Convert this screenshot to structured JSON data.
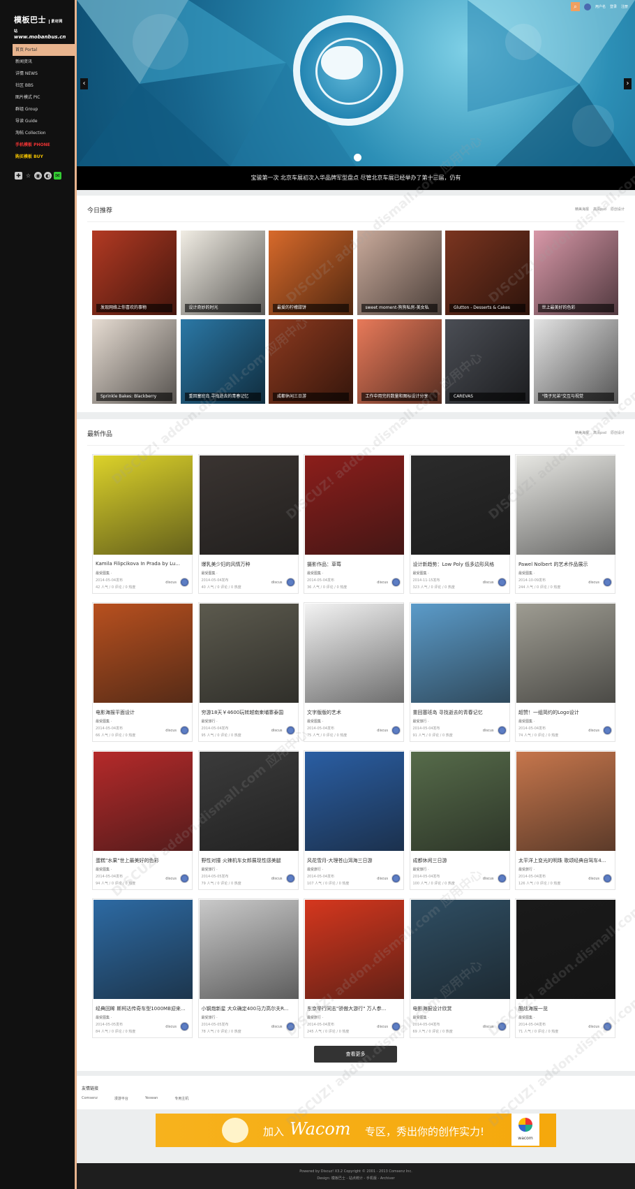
{
  "logo": {
    "line1": "模板巴士",
    "line1b": "素材网站",
    "line2": "www.mobanbus.cn"
  },
  "nav": [
    {
      "label": "首页 Portal",
      "active": true
    },
    {
      "label": "新闻资讯"
    },
    {
      "label": "详情 NEWS"
    },
    {
      "label": "社区 BBS"
    },
    {
      "label": "图片模式 PIC"
    },
    {
      "label": "群组 Group"
    },
    {
      "label": "导读 Guide"
    },
    {
      "label": "淘帖 Collection"
    },
    {
      "label": "手机模板 PHONE",
      "color": "red"
    },
    {
      "label": "购买模板 BUY",
      "color": "yellow"
    }
  ],
  "social_icons": [
    "plus-icon",
    "star-icon",
    "weibo-icon",
    "qq-icon",
    "wechat-icon"
  ],
  "topbar": {
    "user": "用户名",
    "login": "登录",
    "register": "注册"
  },
  "banner": {
    "caption": "宝骏第一次  北京车展初次入华品牌军型盘点  尽管北京车展已经举办了第十三届，仍有",
    "prev": "‹",
    "next": "›"
  },
  "today": {
    "title": "今日推荐",
    "links": [
      "精美海报",
      "高清psd",
      "原创设计"
    ],
    "tiles": [
      {
        "caption": "发现网络上你喜欢的事物",
        "bg": "#b33a23"
      },
      {
        "caption": "设计奇妙的时光",
        "bg": "#f1ede4"
      },
      {
        "caption": "最爱的柠檬甜饼",
        "bg": "#d86a2b"
      },
      {
        "caption": "sweet moment-狗狗私房-美女私",
        "bg": "#c9aa9b"
      },
      {
        "caption": "Glutton - Desserts & Cakes",
        "bg": "#7b3520"
      },
      {
        "caption": "世上最美好的色彩",
        "bg": "#d898a8"
      },
      {
        "caption": "Sprinkle Bakes: Blackberry",
        "bg": "#e6dcd2"
      },
      {
        "caption": "重回塞班岛 寻找逝去的青春记忆",
        "bg": "#2b78a6"
      },
      {
        "caption": "成都休闲三日游",
        "bg": "#8d3a1f"
      },
      {
        "caption": "工作中用完的数量和图标设计分享",
        "bg": "#e87a5a"
      },
      {
        "caption": "CAREVAS",
        "bg": "#4b4e55"
      },
      {
        "caption": "\"筷子兄弟\"交互与视觉",
        "bg": "#e3e3e3"
      }
    ]
  },
  "works": {
    "title": "最新作品",
    "links": [
      "精美海报",
      "高清psd",
      "原创设计"
    ],
    "more": "查看更多",
    "items": [
      {
        "title": "Kamila Filipcikova In Prada by Lu...",
        "cat": "最受图集 ·",
        "date": "2014-05-04发布",
        "stats": "42 人气 / 0 评论 / 0 热度",
        "user": "discus",
        "bg": "#dcd22a"
      },
      {
        "title": "爆乳美少妇的风情万种",
        "cat": "最受图集 ·",
        "date": "2014-05-04发布",
        "stats": "40 人气 / 0 评论 / 0 热度",
        "user": "discus",
        "bg": "#3a3431"
      },
      {
        "title": "摄影作品：草莓",
        "cat": "最受图集 ·",
        "date": "2014-05-04发布",
        "stats": "36 人气 / 0 评论 / 0 热度",
        "user": "discus",
        "bg": "#8c1e1b"
      },
      {
        "title": "设计新趋势：Low Poly 低多边形风格",
        "cat": "最受图集 ·",
        "date": "2014-11-15发布",
        "stats": "323 人气 / 0 评论 / 0 热度",
        "user": "discus",
        "bg": "#2b2b2b"
      },
      {
        "title": "Pawel Nolbert 的艺术作品展示",
        "cat": "最受图集 ·",
        "date": "2014-10-09发布",
        "stats": "244 人气 / 0 评论 / 0 热度",
        "user": "discus",
        "bg": "#e7e7e3"
      },
      {
        "title": "电影海报平面设计",
        "cat": "最受图集 ·",
        "date": "2014-05-04发布",
        "stats": "66 人气 / 0 评论 / 0 热度",
        "user": "discus",
        "bg": "#b8501f"
      },
      {
        "title": "穷游18天￥4600玩转越南柬埔寨泰国",
        "cat": "最受旅行 ·",
        "date": "2014-05-04发布",
        "stats": "95 人气 / 0 评论 / 0 热度",
        "user": "discus",
        "bg": "#5c5a4e"
      },
      {
        "title": "文字版版的艺术",
        "cat": "最受图集 ·",
        "date": "2014-05-04发布",
        "stats": "75 人气 / 0 评论 / 0 热度",
        "user": "discus",
        "bg": "#f3f3f3"
      },
      {
        "title": "重回塞班岛 寻找逝去的青春记忆",
        "cat": "最受旅行 ·",
        "date": "2014-05-04发布",
        "stats": "91 人气 / 0 评论 / 0 热度",
        "user": "discus",
        "bg": "#5b9bc9"
      },
      {
        "title": "超赞！一组简约的Logo设计",
        "cat": "最受图集 ·",
        "date": "2014-05-04发布",
        "stats": "74 人气 / 0 评论 / 0 热度",
        "user": "discus",
        "bg": "#9e9c92"
      },
      {
        "title": "蛋糕\"水果\"世上最美好的色彩",
        "cat": "最受图集 ·",
        "date": "2014-05-04发布",
        "stats": "94 人气 / 0 评论 / 0 热度",
        "user": "discus",
        "bg": "#b52a2a"
      },
      {
        "title": "野性对撞 火辣机车女郎展现性感美腿",
        "cat": "最受旅行 ·",
        "date": "2014-05-05发布",
        "stats": "79 人气 / 0 评论 / 0 热度",
        "user": "discus",
        "bg": "#3b3b3b"
      },
      {
        "title": "风花雪月-大理苍山洱海三日游",
        "cat": "最受旅行 ·",
        "date": "2014-05-04发布",
        "stats": "107 人气 / 0 评论 / 0 热度",
        "user": "discus",
        "bg": "#2a5ea3"
      },
      {
        "title": "成都休闲三日游",
        "cat": "最受旅行 ·",
        "date": "2014-05-04发布",
        "stats": "100 人气 / 0 评论 / 0 热度",
        "user": "discus",
        "bg": "#566b4a"
      },
      {
        "title": "太平洋上变光的明珠 歌颂经典自驾车4...",
        "cat": "最受旅行 ·",
        "date": "2014-05-04发布",
        "stats": "126 人气 / 0 评论 / 0 热度",
        "user": "discus",
        "bg": "#c6764c"
      },
      {
        "title": "经典回眸 斯柯达传奇车型1000MB迎来...",
        "cat": "最受图集 ·",
        "date": "2014-05-05发布",
        "stats": "84 人气 / 0 评论 / 0 热度",
        "user": "discus",
        "bg": "#2d6aa3"
      },
      {
        "title": "小钢炮新星 大众确定400马力高尔夫R...",
        "cat": "最受旅行 ·",
        "date": "2014-05-05发布",
        "stats": "78 人气 / 0 评论 / 0 热度",
        "user": "discus",
        "bg": "#c9c9c9"
      },
      {
        "title": "东京举行同志\"骄傲大游行\" 万人参...",
        "cat": "最受旅行 ·",
        "date": "2014-05-04发布",
        "stats": "245 人气 / 0 评论 / 0 热度",
        "user": "discus",
        "bg": "#d5371e"
      },
      {
        "title": "电影海报设计欣赏",
        "cat": "最受图集 ·",
        "date": "2014-05-04发布",
        "stats": "69 人气 / 0 评论 / 0 热度",
        "user": "discus",
        "bg": "#2f4e63"
      },
      {
        "title": "酷炫海报一览",
        "cat": "最受图集 ·",
        "date": "2014-05-04发布",
        "stats": "71 人气 / 0 评论 / 0 热度",
        "user": "discus",
        "bg": "#1a1a1a"
      }
    ]
  },
  "friends": {
    "title": "友情链接",
    "links": [
      "Comsenz",
      "漫游平台",
      "Yeswan",
      "专用主机"
    ]
  },
  "ad": {
    "text1": "加入",
    "brand": "Wacom",
    "text2": "专区，秀出你的创作实力!",
    "logo": "wacom"
  },
  "footer": {
    "line1": "Powered by Discuz! X3.2 Copyright © 2001 - 2013 Comsenz Inc.",
    "line2": "Design: 模板巴士 - 站点统计 - 手机版 - Archiver"
  },
  "watermark": "DISCUZ! addon.dismall.com 应用中心"
}
